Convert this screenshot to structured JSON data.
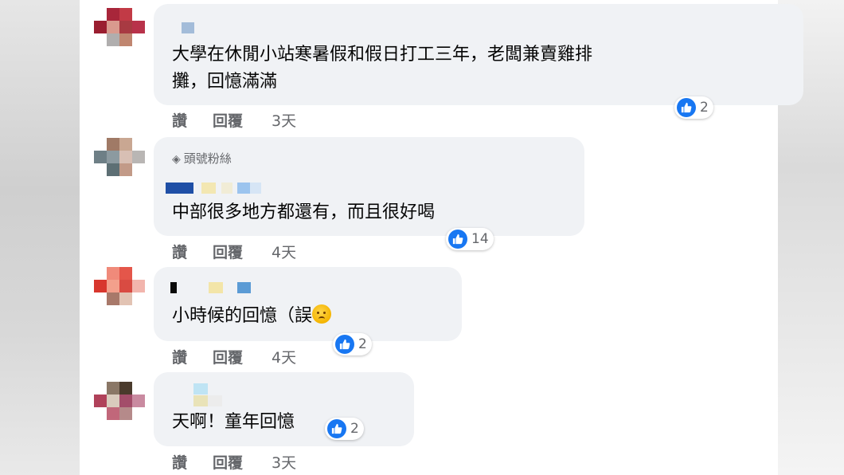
{
  "labels": {
    "like_action": "讚",
    "reply_action": "回覆",
    "top_fan_badge": "頭號粉絲"
  },
  "icons": {
    "like_reaction": "thumbs-up-icon",
    "top_fan": "diamond-icon",
    "emoji": "pleading-face-emoji"
  },
  "colors": {
    "bubble": "#f0f2f5",
    "like_blue": "#1877f2",
    "meta_text": "#65676b",
    "body_text": "#050505"
  },
  "comments": [
    {
      "text_line1": "大學在休閒小站寒暑假和假日打工三年，老闆兼賣雞排",
      "text_line2": "攤，回憶滿滿",
      "reactions": "2",
      "time": "3天"
    },
    {
      "text": "中部很多地方都還有，而且很好喝",
      "reactions": "14",
      "time": "4天"
    },
    {
      "text": "小時候的回憶（誤",
      "reactions": "2",
      "time": "4天"
    },
    {
      "text": "天啊！童年回憶",
      "reactions": "2",
      "time": "3天"
    }
  ]
}
